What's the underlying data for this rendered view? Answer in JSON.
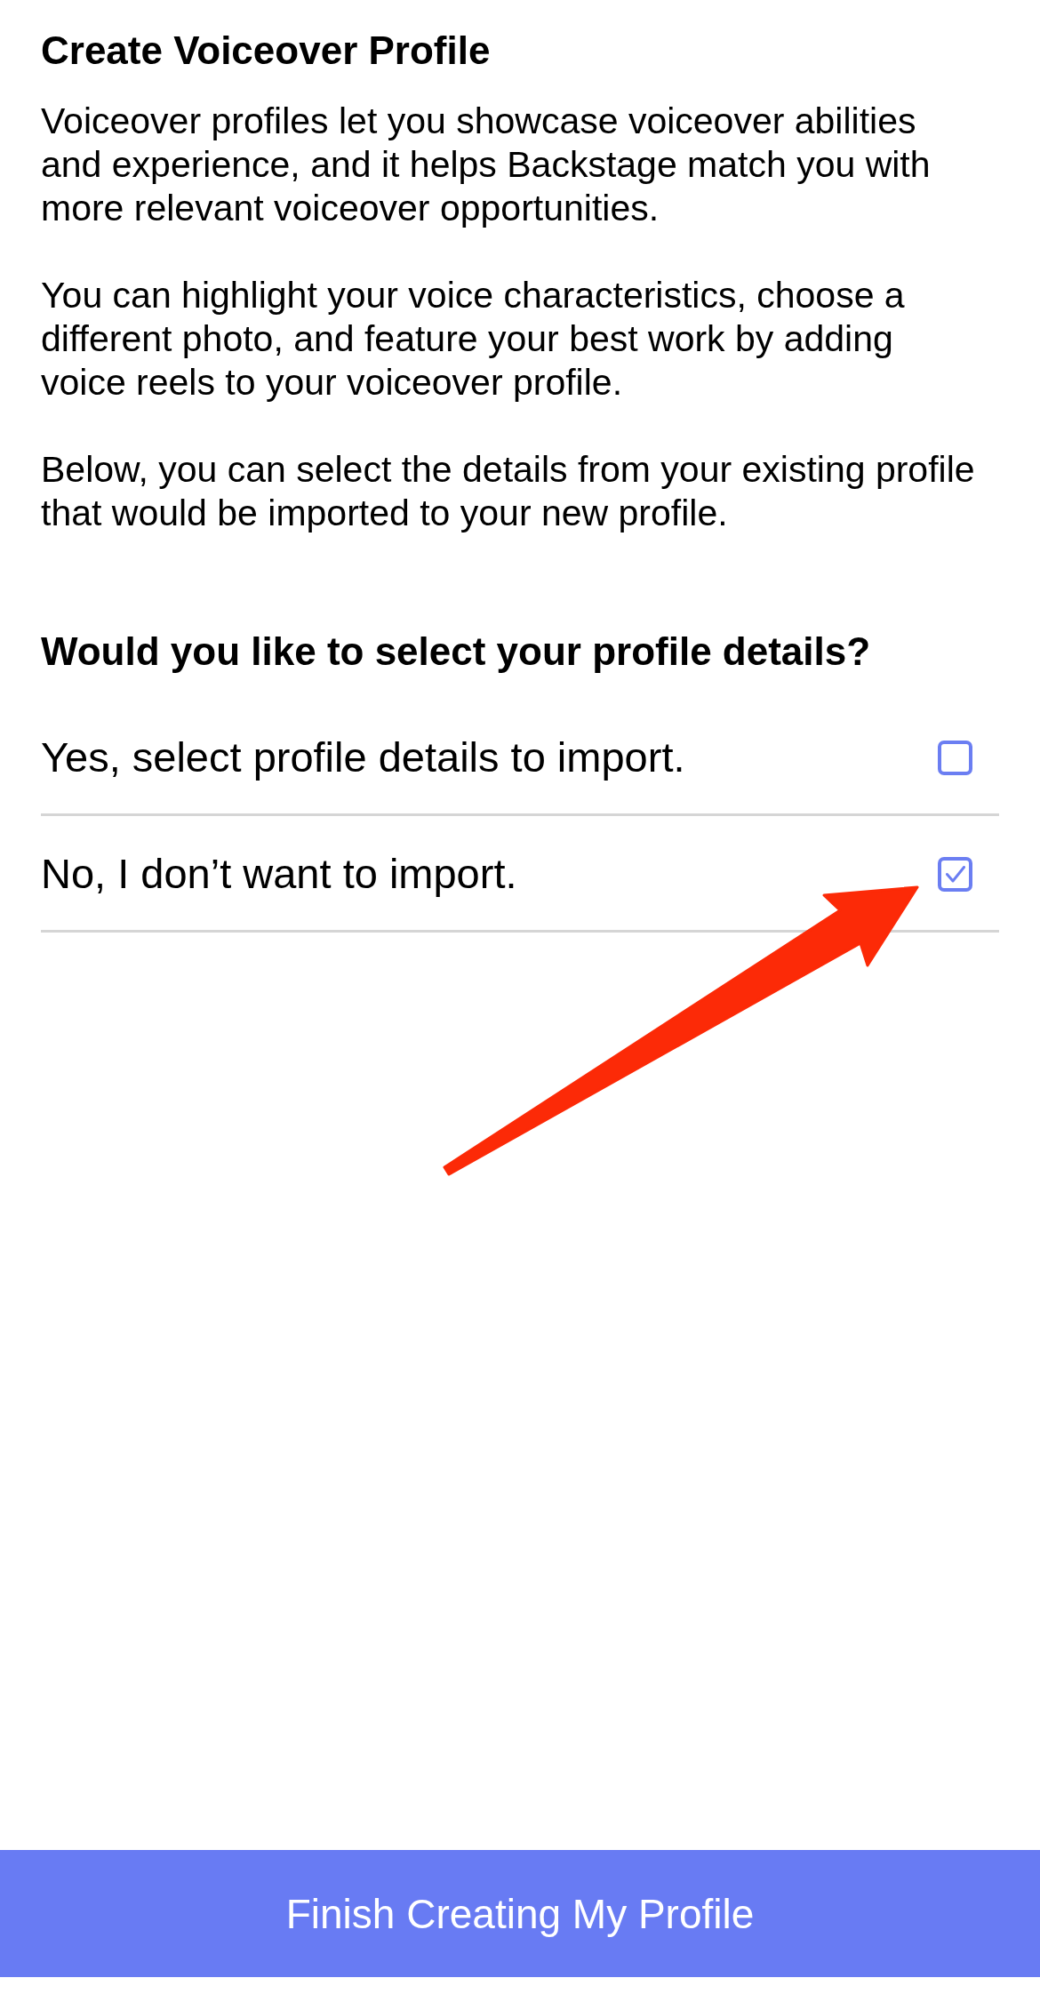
{
  "title": "Create Voiceover Profile",
  "intro": [
    "Voiceover profiles let you showcase voiceover abilities and experience, and it helps Backstage match you with more relevant voiceover opportunities.",
    "You can highlight your voice characteristics, choose a different photo, and feature your best work by adding voice reels to your voiceover profile.",
    "Below, you can select the details from your existing profile that would be imported to your new profile."
  ],
  "question": "Would you like to select your profile details?",
  "options": [
    {
      "label": "Yes, select profile details to import.",
      "checked": false
    },
    {
      "label": "No, I don’t want to import.",
      "checked": true
    }
  ],
  "finish_button": "Finish Creating My Profile"
}
